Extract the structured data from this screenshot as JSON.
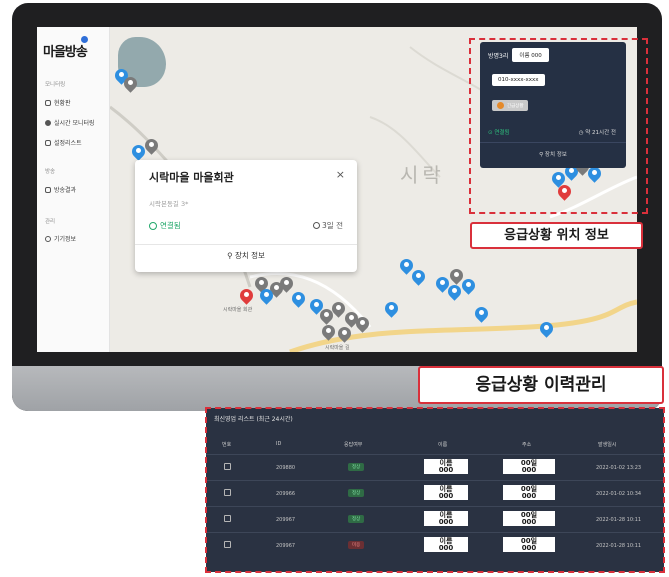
{
  "sidebar": {
    "logo": "마을방송",
    "sections": [
      {
        "label": "모니터링",
        "items": [
          "현황판",
          "실시간 모니터링",
          "설정리스트"
        ]
      },
      {
        "label": "방송",
        "items": [
          "방송결과"
        ]
      },
      {
        "label": "관리",
        "items": [
          "기기정보"
        ]
      }
    ]
  },
  "map": {
    "town_label": "시락",
    "place_labels": {
      "hall": "시락마을 회관",
      "road": "시락마을 길"
    }
  },
  "info_card": {
    "title": "시락마을 마을회관",
    "close": "×",
    "address": "시락본동길 3*",
    "status": "연결됨",
    "time": "3일 전",
    "detail_button": "장치 정보"
  },
  "dark_popup": {
    "header_label": "방명3리",
    "chip": "이름 000",
    "phone": "010-xxxx-xxxx",
    "button_label": "긴급상황",
    "status": "연결됨",
    "time": "약 21시간 전",
    "detail": "장치 정보"
  },
  "callouts": {
    "location": "응급상황 위치 정보",
    "history": "응급상황 이력관리"
  },
  "history": {
    "title": "최신영업 리스트 (최근 24시간)",
    "columns": [
      "번호",
      "ID",
      "응답여부",
      "이름",
      "주소",
      "발생일시"
    ],
    "rows": [
      {
        "id": "209880",
        "status": "정상",
        "name_top": "이름",
        "name_bottom": "000",
        "loc_top": "00일",
        "loc_bottom": "000",
        "date": "2022-01-02 13:23"
      },
      {
        "id": "209966",
        "status": "정상",
        "name_top": "이름",
        "name_bottom": "000",
        "loc_top": "00일",
        "loc_bottom": "000",
        "date": "2022-01-02 10:34"
      },
      {
        "id": "209967",
        "status": "정상",
        "name_top": "이름",
        "name_bottom": "000",
        "loc_top": "00일",
        "loc_bottom": "000",
        "date": "2022-01-28 10:11"
      },
      {
        "id": "209967",
        "status": "미응",
        "name_top": "이름",
        "name_bottom": "000",
        "loc_top": "00일",
        "loc_bottom": "000",
        "date": "2022-01-28 10:11"
      }
    ]
  },
  "colors": {
    "accent_red": "#d9303b",
    "pin_blue": "#2e8fe0",
    "ok_green": "#22a86b",
    "panel_dark": "#2a3242"
  }
}
